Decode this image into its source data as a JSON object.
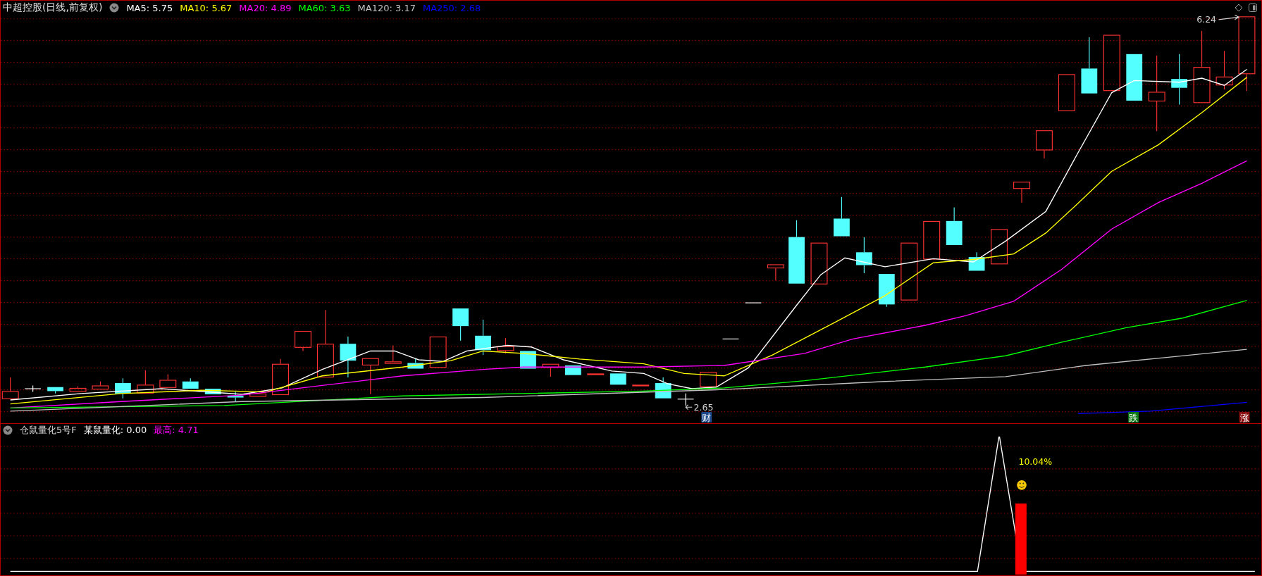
{
  "chart_title": {
    "name": "中超控股",
    "period": "(日线,前复权)"
  },
  "ma_legend": [
    {
      "label": "MA5: 5.75",
      "color": "#ffffff"
    },
    {
      "label": "MA10: 5.67",
      "color": "#ffff00"
    },
    {
      "label": "MA20: 4.89",
      "color": "#ff00ff"
    },
    {
      "label": "MA60: 3.63",
      "color": "#00ff00"
    },
    {
      "label": "MA120: 3.17",
      "color": "#c0c0c0"
    },
    {
      "label": "MA250: 2.68",
      "color": "#0000ff"
    }
  ],
  "price_markers": {
    "high": "6.24",
    "low": "2.65"
  },
  "event_markers": [
    {
      "label": "财",
      "color": "#1c4a8c"
    },
    {
      "label": "跌",
      "color": "#0b7a16"
    },
    {
      "label": "涨",
      "color": "#8c1010"
    }
  ],
  "indicator": {
    "name": "仓鼠量化5号F",
    "values": [
      {
        "label": "某鼠量化: 0.00",
        "color": "#ffffff"
      },
      {
        "label": "最高: 4.71",
        "color": "#ff00ff"
      }
    ],
    "signal_text": "10.04%"
  }
}
